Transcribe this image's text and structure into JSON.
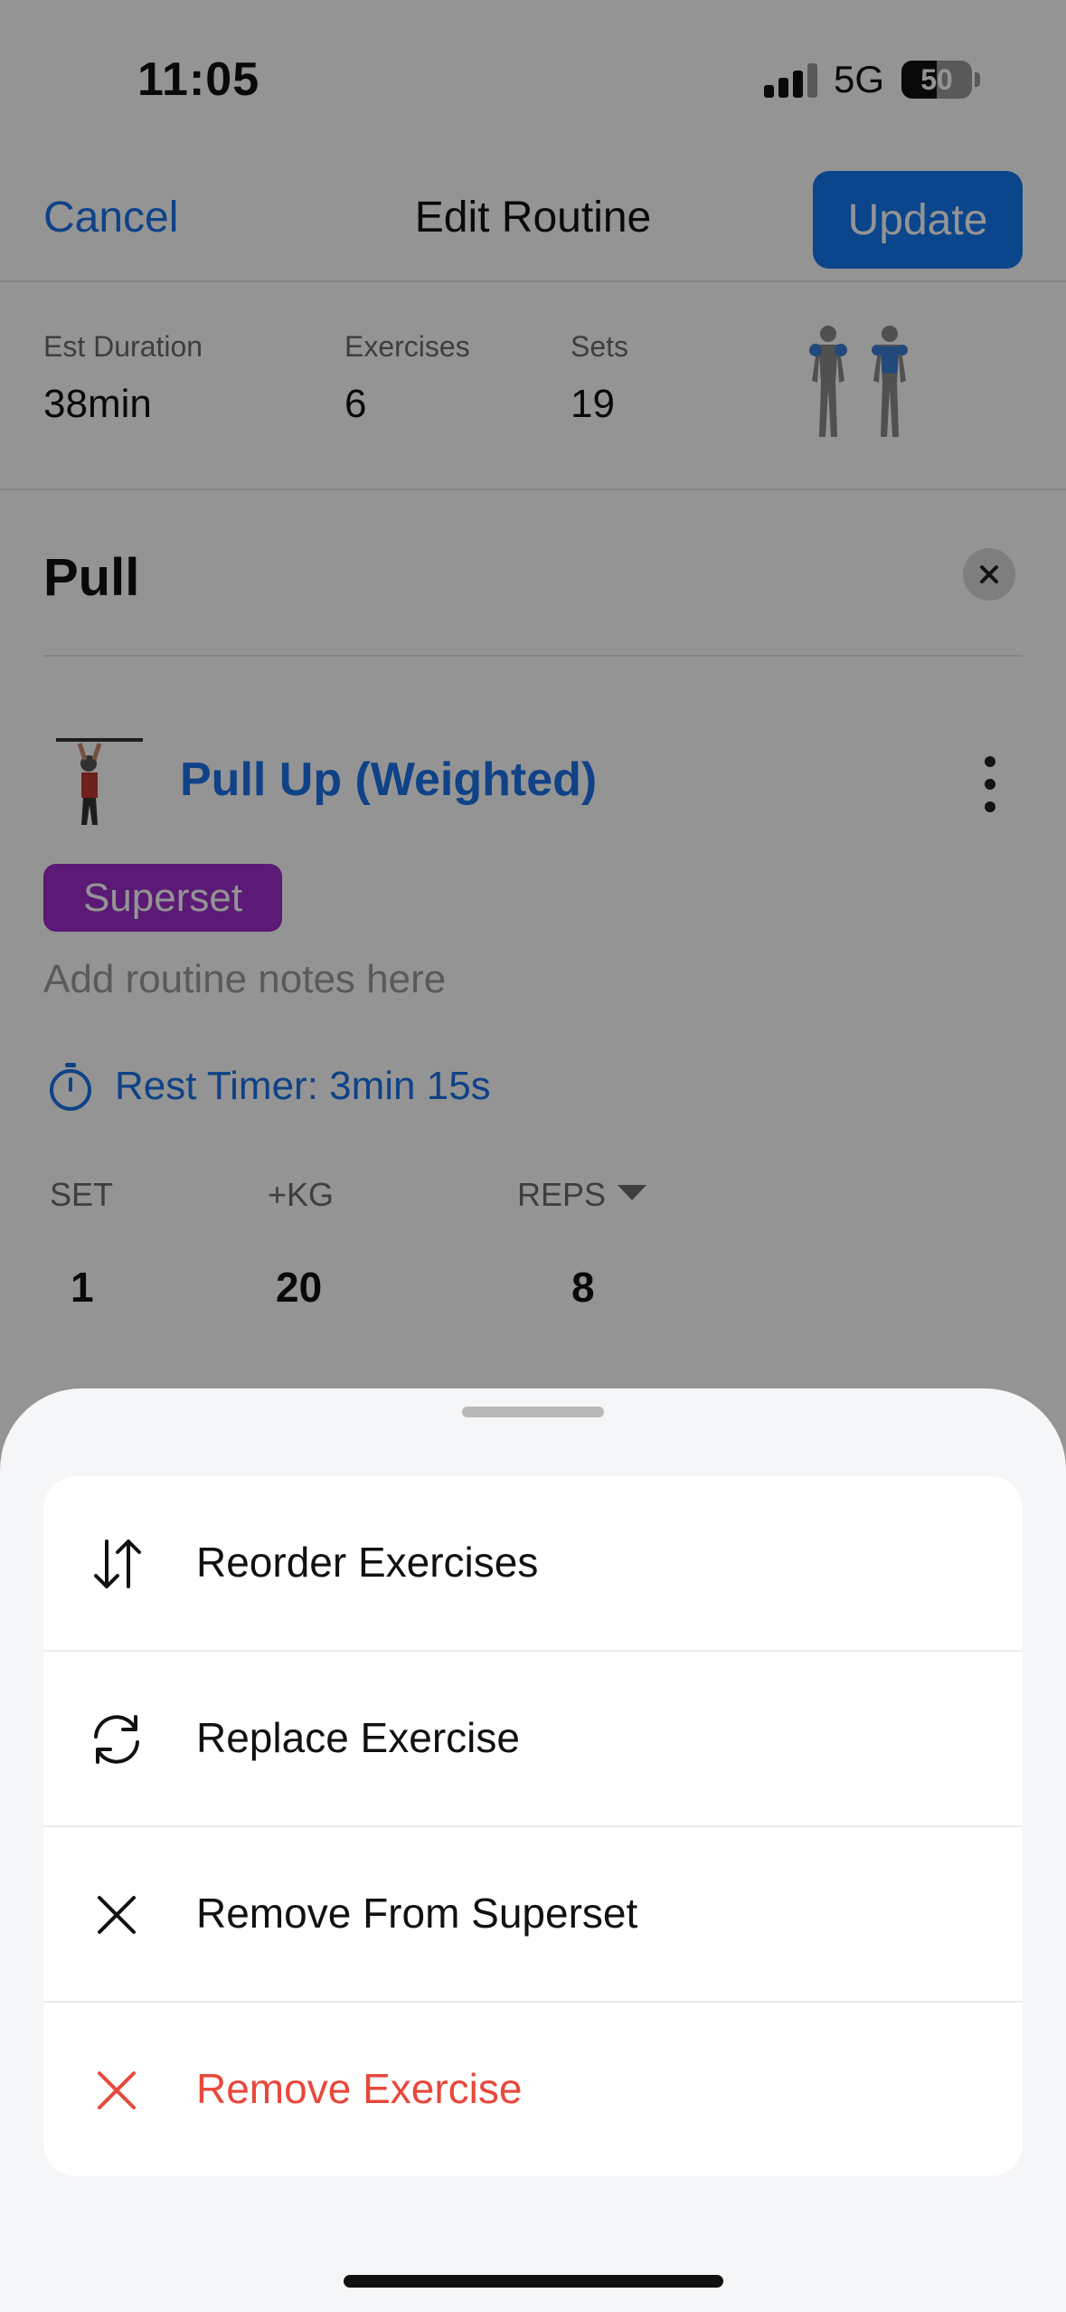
{
  "status_bar": {
    "time": "11:05",
    "network": "5G",
    "battery_percent": "50",
    "battery_level": 0.5
  },
  "nav": {
    "cancel_label": "Cancel",
    "title": "Edit Routine",
    "update_label": "Update"
  },
  "stats": [
    {
      "label": "Est Duration",
      "value": "38min"
    },
    {
      "label": "Exercises",
      "value": "6"
    },
    {
      "label": "Sets",
      "value": "19"
    }
  ],
  "routine": {
    "title": "Pull",
    "exercise": {
      "name": "Pull Up (Weighted)",
      "badge": "Superset",
      "notes_placeholder": "Add routine notes here",
      "rest_timer": "Rest Timer: 3min 15s",
      "columns": [
        "SET",
        "+KG",
        "REPS"
      ],
      "sets": [
        {
          "set": "1",
          "kg": "20",
          "reps": "8"
        }
      ]
    }
  },
  "sheet": {
    "items": [
      {
        "label": "Reorder Exercises",
        "icon": "reorder-icon"
      },
      {
        "label": "Replace Exercise",
        "icon": "replace-icon"
      },
      {
        "label": "Remove From Superset",
        "icon": "close-icon"
      },
      {
        "label": "Remove Exercise",
        "icon": "close-icon"
      }
    ]
  },
  "colors": {
    "accent": "#1478f0",
    "superset": "#9b2dcb",
    "danger": "#e8483c"
  }
}
